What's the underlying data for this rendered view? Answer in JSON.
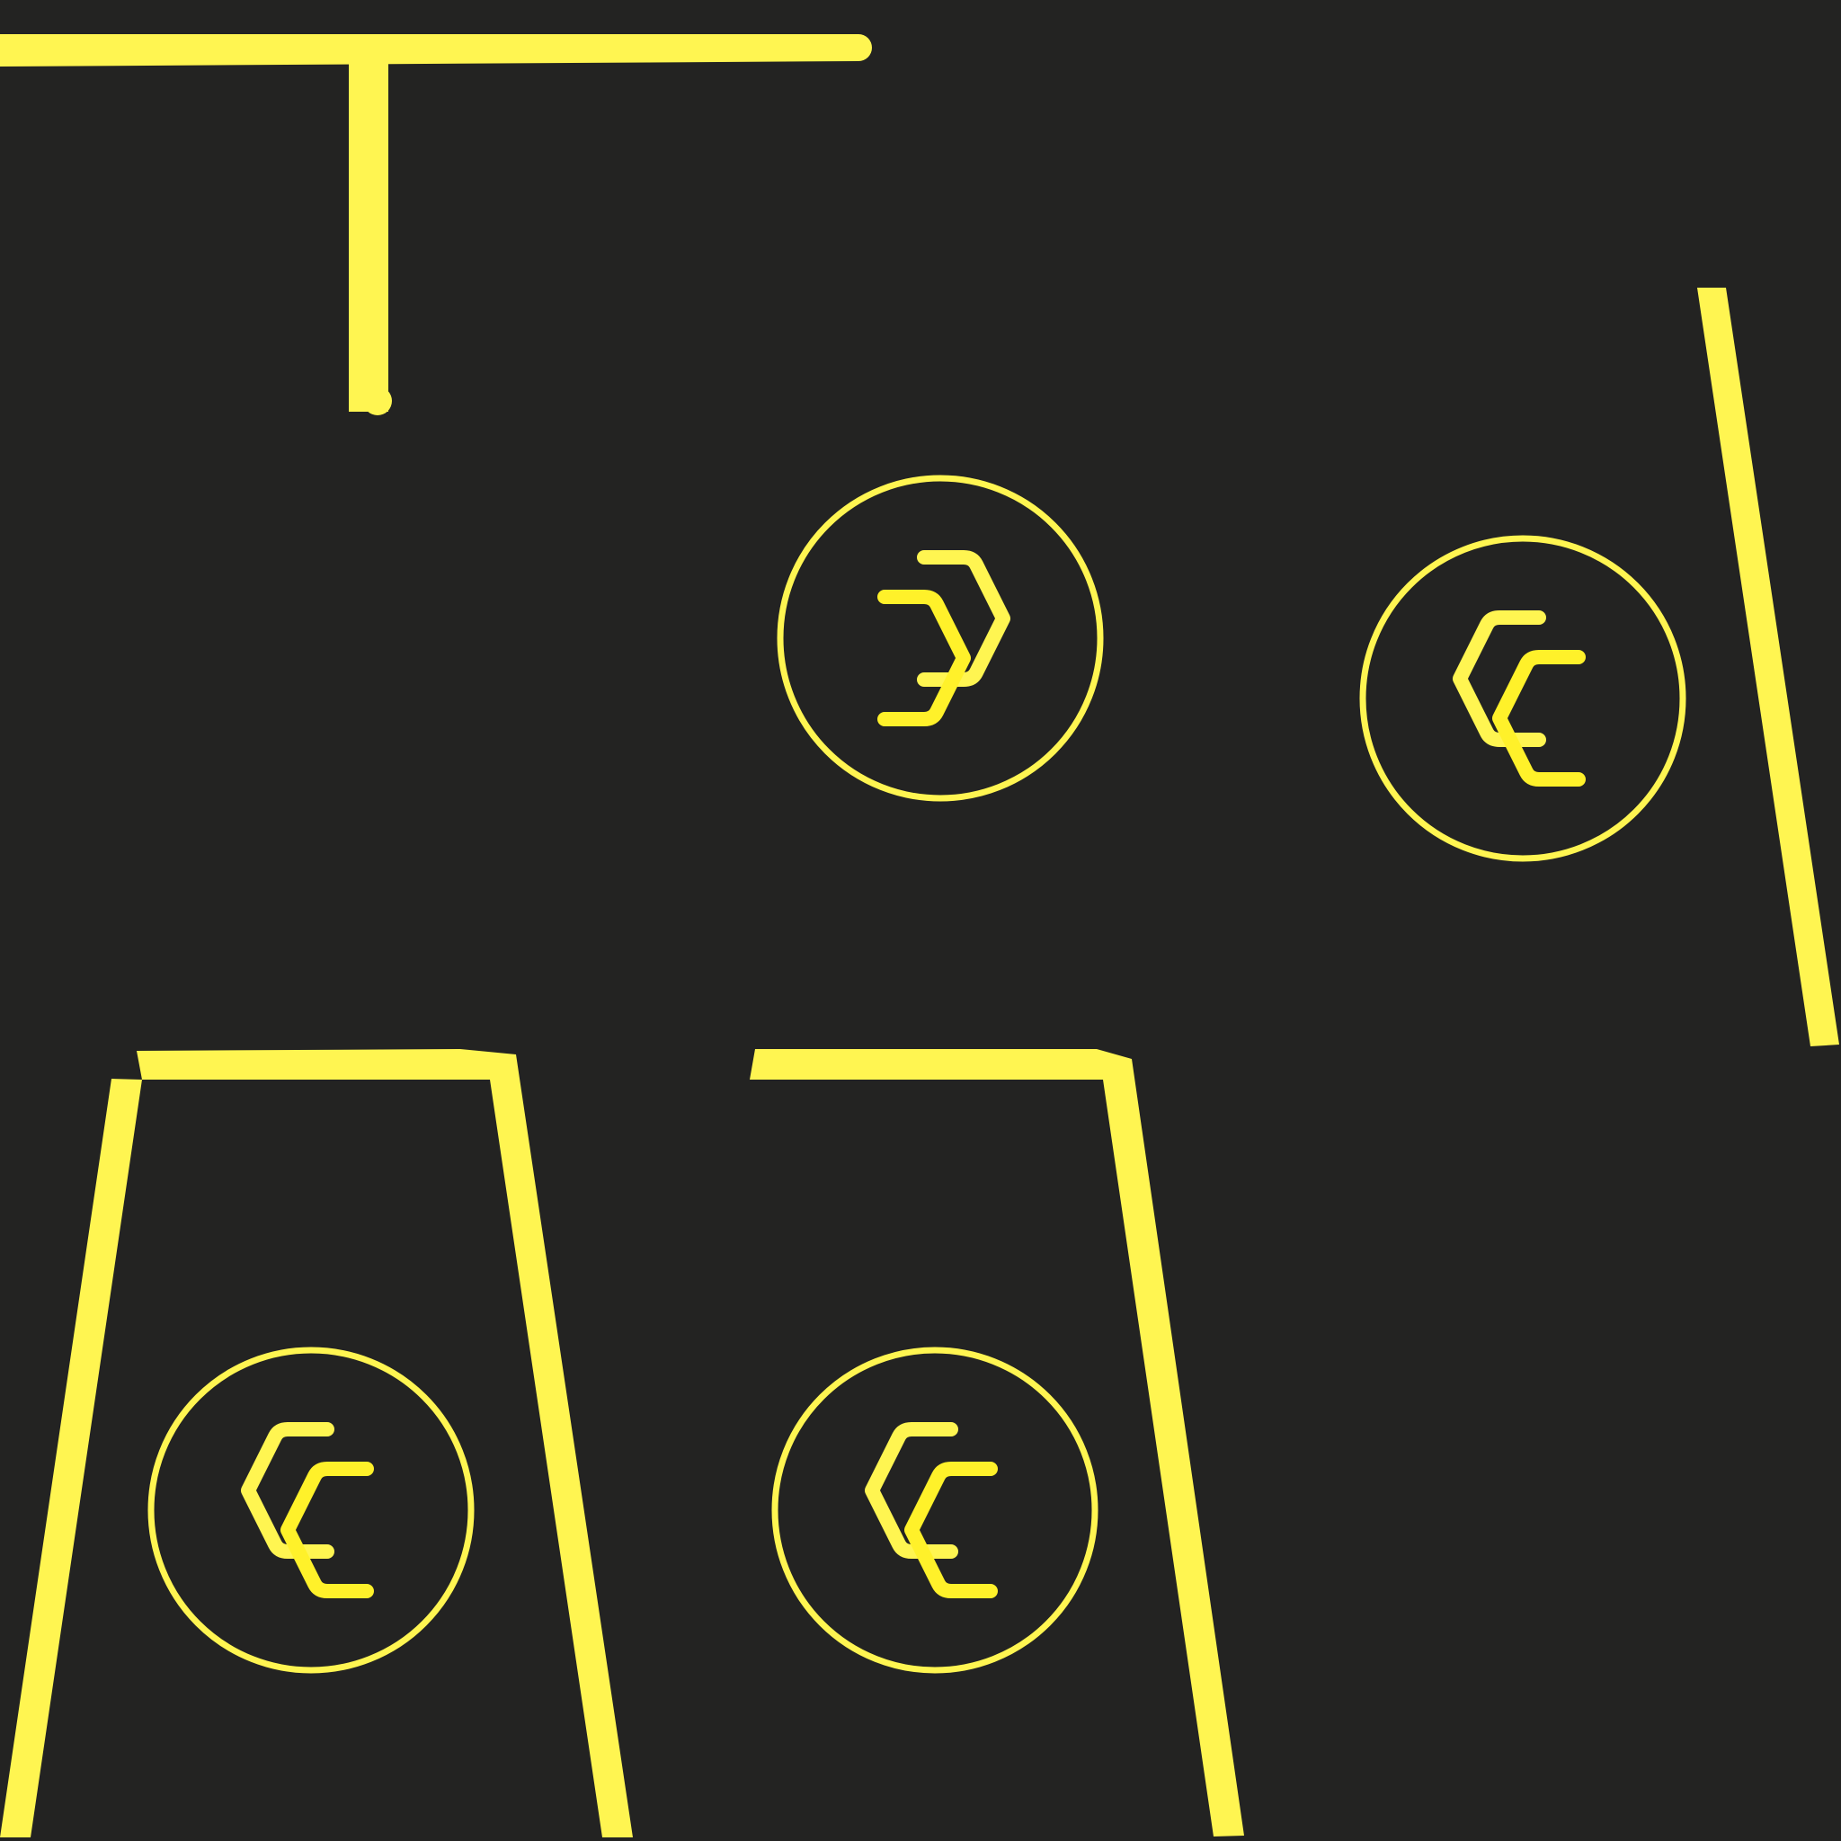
{
  "colors": {
    "background": "#232322",
    "accent": "#FFF551",
    "accent_bright": "#FFF12A"
  },
  "icons": {
    "chevron": "double-chevron-icon",
    "ring": "circle-outline"
  },
  "buttons": [
    {
      "id": "double-chevron-right-button",
      "direction": "right"
    },
    {
      "id": "double-chevron-left-button",
      "direction": "left"
    },
    {
      "id": "double-chevron-left-button-bottom-left",
      "direction": "left"
    },
    {
      "id": "double-chevron-left-button-bottom-middle",
      "direction": "left"
    }
  ]
}
